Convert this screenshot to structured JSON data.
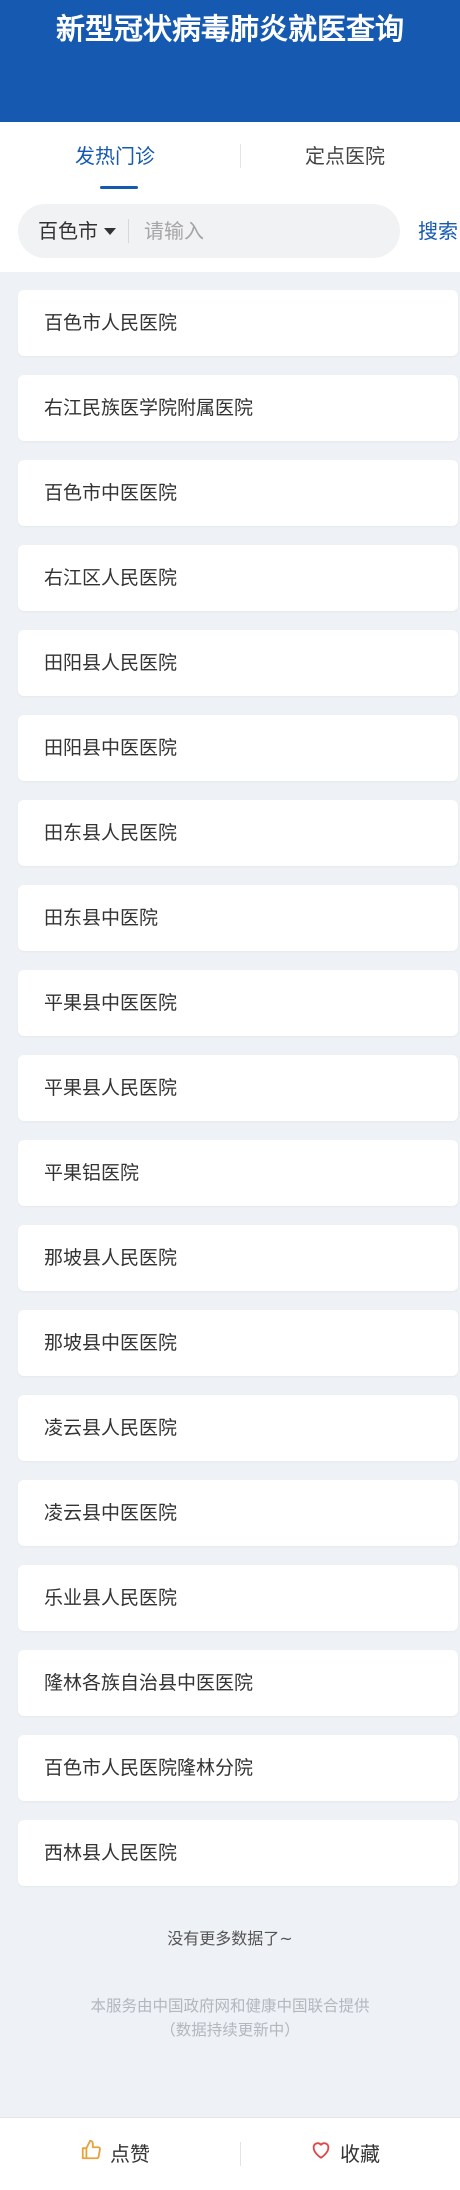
{
  "header": {
    "title": "新型冠状病毒肺炎就医查询",
    "background_color": "#1559b0"
  },
  "tabs": [
    {
      "label": "发热门诊",
      "active": true
    },
    {
      "label": "定点医院",
      "active": false
    }
  ],
  "search": {
    "city": "百色市",
    "placeholder": "请输入",
    "value": "",
    "button_label": "搜索"
  },
  "hospitals": [
    "百色市人民医院",
    "右江民族医学院附属医院",
    "百色市中医医院",
    "右江区人民医院",
    "田阳县人民医院",
    "田阳县中医医院",
    "田东县人民医院",
    "田东县中医院",
    "平果县中医医院",
    "平果县人民医院",
    "平果铝医院",
    "那坡县人民医院",
    "那坡县中医医院",
    "凌云县人民医院",
    "凌云县中医医院",
    "乐业县人民医院",
    "隆林各族自治县中医医院",
    "百色市人民医院隆林分院",
    "西林县人民医院"
  ],
  "no_more": "没有更多数据了~",
  "footer": {
    "line1": "本服务由中国政府网和健康中国联合提供",
    "line2": "（数据持续更新中）"
  },
  "bottom_bar": {
    "like_label": "点赞",
    "like_icon": "thumbs-up-icon",
    "like_color": "#e8a33d",
    "favorite_label": "收藏",
    "favorite_icon": "heart-icon",
    "favorite_color": "#e0464a"
  },
  "colors": {
    "accent": "#1559b0",
    "page_background": "#eef1f5"
  }
}
